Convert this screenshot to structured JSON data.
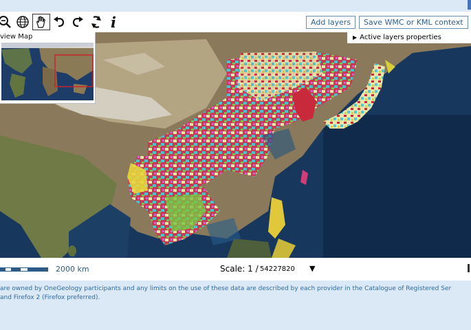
{
  "toolbar": {
    "tools": [
      "zoom-out-icon",
      "globe-icon",
      "hand-pan-icon",
      "undo-icon",
      "redo-icon",
      "refresh-icon",
      "info-icon"
    ],
    "info_glyph": "i",
    "add_layers_label": "Add layers",
    "save_context_label": "Save WMC or KML context"
  },
  "active_layers": {
    "label": "Active layers properties"
  },
  "overview": {
    "title": "view Map"
  },
  "scale": {
    "distance_label": "2000 km",
    "label": "Scale: 1 /",
    "value": "54227820"
  },
  "footer": {
    "line1": "are owned by OneGeology participants and any limits on the use of these data are described by each provider in the Catalogue of Registered Ser",
    "line2": "and Firefox 2 (Firefox preferred)."
  },
  "colors": {
    "ocean": "#18375c",
    "accent_link": "#2d6aa3",
    "button_border": "#6a8fb6",
    "overview_box": "#d11f2a"
  }
}
